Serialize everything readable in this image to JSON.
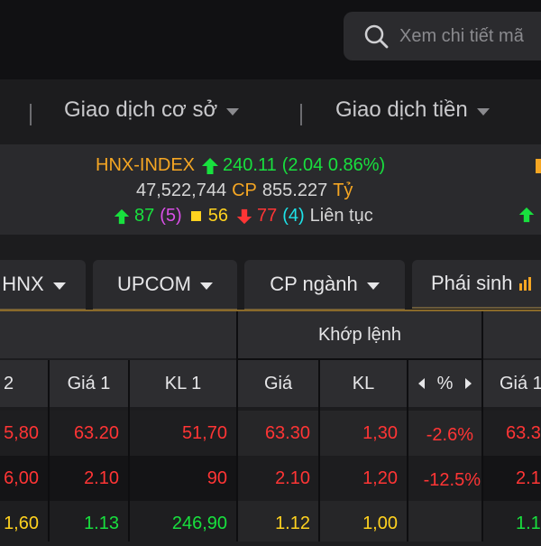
{
  "search": {
    "placeholder": "Xem chi tiết mã"
  },
  "menu": {
    "item1": "Giao dịch cơ sở",
    "item2": "Giao dịch tiền"
  },
  "index": {
    "name": "HNX-INDEX",
    "value": "240.11",
    "change": "(2.04 0.86%)",
    "volume": "47,522,744",
    "cp_label": "CP",
    "value_traded": "855.227",
    "unit": "Tỷ",
    "up_count": "87",
    "ceiling_count": "(5)",
    "unchanged_count": "56",
    "down_count": "77",
    "floor_count": "(4)",
    "session": "Liên tục"
  },
  "tabs": [
    "HNX",
    "UPCOM",
    "CP ngành",
    "Phái sinh"
  ],
  "table": {
    "group_header": "Khớp lệnh",
    "headers": [
      "2",
      "Giá 1",
      "KL 1",
      "Giá",
      "KL",
      "%",
      "Giá 1"
    ],
    "rows": [
      [
        "5,80",
        "63.20",
        "51,70",
        "63.30",
        "1,30",
        "-2.6%",
        "63.3"
      ],
      [
        "6,00",
        "2.10",
        "90",
        "2.10",
        "1,20",
        "-12.5%",
        "2.1"
      ],
      [
        "1,60",
        "1.13",
        "246,90",
        "1.12",
        "1,00",
        "",
        "1.1"
      ]
    ]
  },
  "colors": {
    "up": "#18e03e",
    "down": "#ff3535",
    "reference": "#ffd21f",
    "ceiling": "#d94fe6",
    "floor": "#1ee2e8",
    "accent": "#f5a623"
  }
}
